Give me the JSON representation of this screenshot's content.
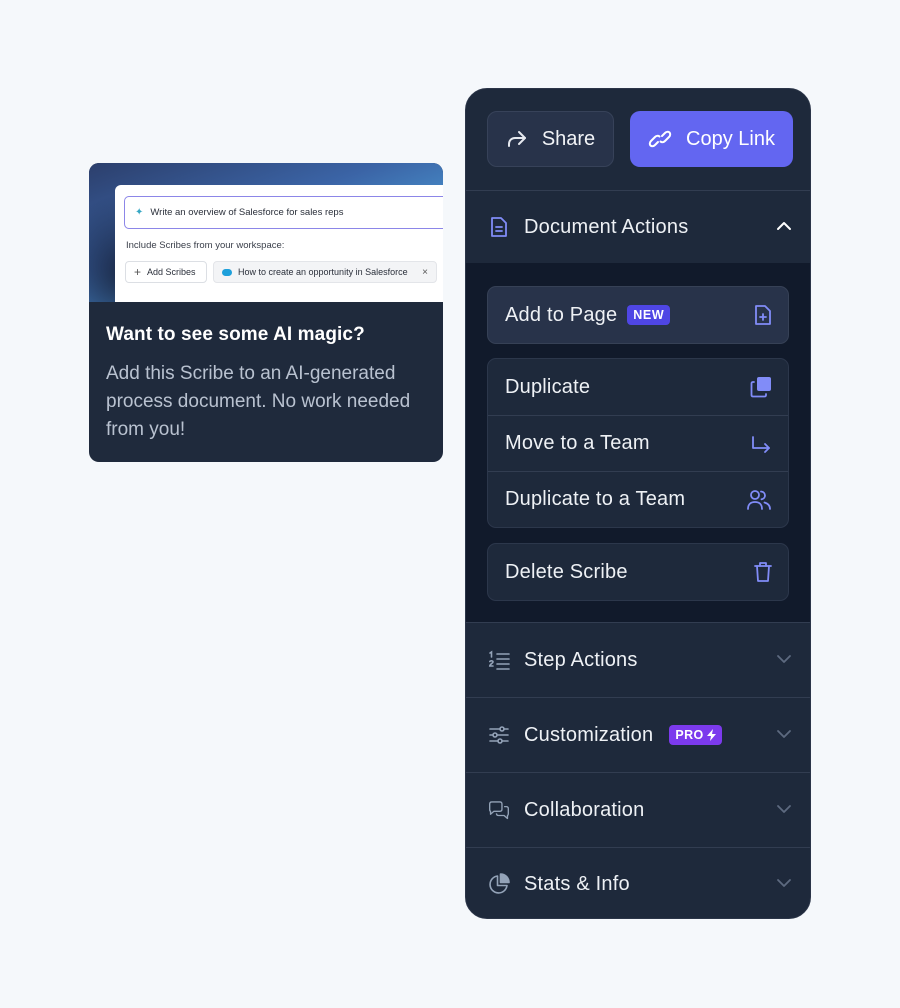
{
  "promo": {
    "prompt_text": "Write an overview of Salesforce for sales reps",
    "include_label": "Include Scribes from your workspace:",
    "add_scribes_label": "Add Scribes",
    "scribe_chip_label": "How to create an opportunity in Salesforce",
    "chip_remove": "×",
    "title": "Want to see some AI magic?",
    "body": "Add this Scribe to an AI-generated process document. No work needed from you!"
  },
  "actions": {
    "share_label": "Share",
    "copy_link_label": "Copy Link"
  },
  "sections": {
    "document_actions": {
      "label": "Document Actions",
      "expanded": true,
      "items": {
        "add_to_page": {
          "label": "Add to Page",
          "badge": "NEW"
        },
        "duplicate": {
          "label": "Duplicate"
        },
        "move_to_team": {
          "label": "Move to a Team"
        },
        "duplicate_to_team": {
          "label": "Duplicate to a Team"
        },
        "delete_scribe": {
          "label": "Delete Scribe"
        }
      }
    },
    "step_actions": {
      "label": "Step Actions"
    },
    "customization": {
      "label": "Customization",
      "badge": "PRO"
    },
    "collaboration": {
      "label": "Collaboration"
    },
    "stats_info": {
      "label": "Stats & Info"
    }
  },
  "colors": {
    "accent": "#6366f1",
    "icon_accent": "#818cf8",
    "panel_bg": "#1e293b",
    "pro_badge": "#7c3aed"
  },
  "icons": {
    "share": "share-arrow-icon",
    "copy_link": "link-icon",
    "document_actions": "document-icon",
    "add_to_page": "document-plus-icon",
    "duplicate": "copy-icon",
    "move_to_team": "arrow-turn-down-right-icon",
    "duplicate_to_team": "users-icon",
    "delete_scribe": "trash-icon",
    "step_actions": "numbered-list-icon",
    "customization": "sliders-icon",
    "collaboration": "chat-bubbles-icon",
    "stats_info": "pie-chart-icon"
  }
}
